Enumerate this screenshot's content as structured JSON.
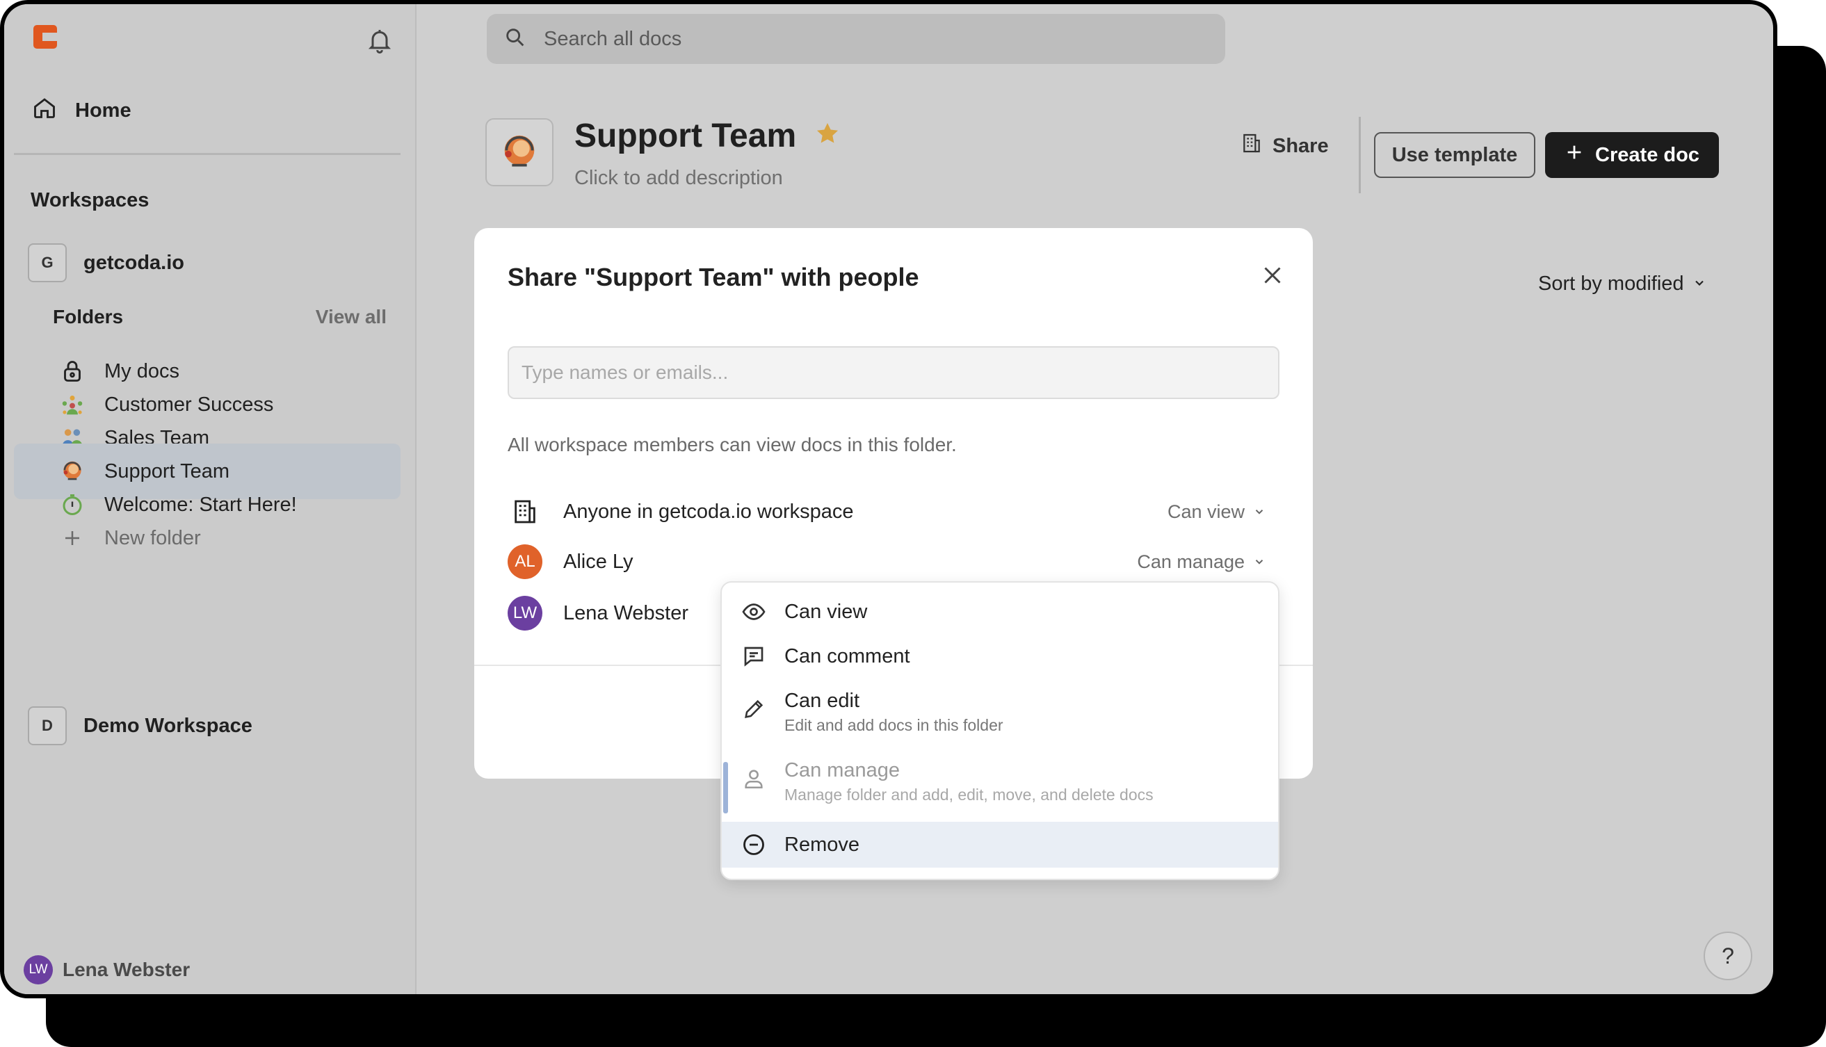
{
  "sidebar": {
    "home_label": "Home",
    "workspaces_heading": "Workspaces",
    "workspaces": [
      {
        "badge": "G",
        "name": "getcoda.io"
      },
      {
        "badge": "D",
        "name": "Demo Workspace"
      }
    ],
    "folders_heading": "Folders",
    "view_all_label": "View all",
    "folders": [
      {
        "label": "My docs",
        "icon": "lock-icon"
      },
      {
        "label": "Customer Success",
        "icon": "team-icon"
      },
      {
        "label": "Sales Team",
        "icon": "people-icon"
      },
      {
        "label": "Support Team",
        "icon": "headset-icon",
        "active": true
      },
      {
        "label": "Welcome: Start Here!",
        "icon": "timer-icon"
      }
    ],
    "new_folder_label": "New folder",
    "user": {
      "initials": "LW",
      "name": "Lena Webster"
    }
  },
  "search": {
    "placeholder": "Search all docs"
  },
  "header": {
    "title": "Support Team",
    "description": "Click to add description",
    "share_label": "Share",
    "use_template_label": "Use template",
    "create_doc_label": "Create doc",
    "sort_label": "Sort by modified"
  },
  "help_label": "?",
  "share_dialog": {
    "title": "Share \"Support Team\" with people",
    "input_placeholder": "Type names or emails...",
    "note": "All workspace members can view docs in this folder.",
    "entries": [
      {
        "name": "Anyone in getcoda.io workspace",
        "permission": "Can view",
        "icon": "building-icon"
      },
      {
        "name": "Alice Ly",
        "initials": "AL",
        "permission": "Can manage",
        "avatar_color": "#e0622a"
      },
      {
        "name": "Lena Webster",
        "initials": "LW",
        "avatar_color": "#6b3fa0"
      }
    ]
  },
  "permission_menu": {
    "items": [
      {
        "label": "Can view",
        "icon": "eye-icon"
      },
      {
        "label": "Can comment",
        "icon": "comment-icon"
      },
      {
        "label": "Can edit",
        "sublabel": "Edit and add docs in this folder",
        "icon": "pencil-icon"
      },
      {
        "label": "Can manage",
        "sublabel": "Manage folder and add, edit, move, and delete docs",
        "icon": "person-icon",
        "disabled": true
      },
      {
        "label": "Remove",
        "icon": "minus-circle-icon",
        "hovered": true
      }
    ]
  },
  "colors": {
    "accent_dark": "#1c1c1c",
    "star": "#d9a441",
    "brand": "#e0571f",
    "hover": "#e9eef5"
  }
}
